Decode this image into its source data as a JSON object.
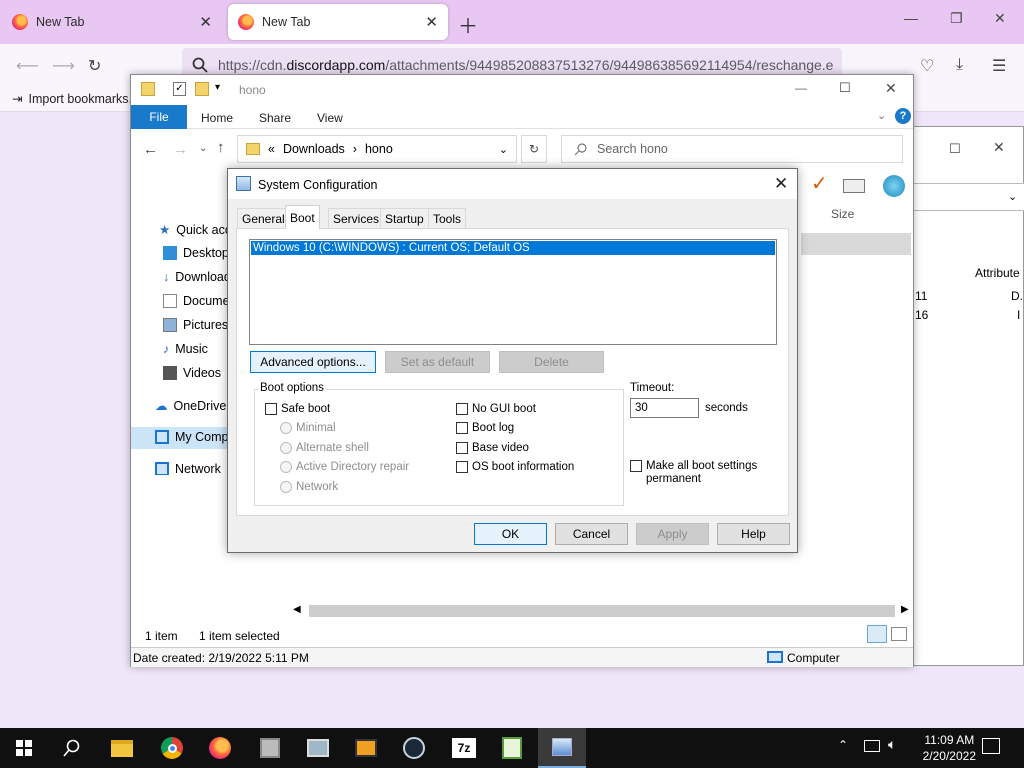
{
  "browser": {
    "tabs": [
      {
        "title": "New Tab"
      },
      {
        "title": "New Tab"
      }
    ],
    "url_prefix": "https://cdn.",
    "url_host": "discordapp.com",
    "url_rest": "/attachments/944985208837513276/944986385692114954/reschange.e",
    "bookmark_import": "Import bookmarks..."
  },
  "explorer": {
    "title": "hono",
    "ribbon_tabs": {
      "file": "File",
      "home": "Home",
      "share": "Share",
      "view": "View"
    },
    "breadcrumb": {
      "parent": "Downloads",
      "current": "hono"
    },
    "search_placeholder": "Search hono",
    "nav": {
      "quick_access": "Quick access",
      "desktop": "Desktop",
      "downloads": "Downloads",
      "documents": "Documents",
      "pictures": "Pictures",
      "music": "Music",
      "videos": "Videos",
      "onedrive": "OneDrive",
      "my_computer": "My Computer",
      "network": "Network"
    },
    "columns": {
      "size": "Size"
    },
    "status": {
      "count": "1 item",
      "selected": "1 item selected"
    },
    "details": {
      "created": "Date created: 2/19/2022 5:11 PM",
      "location": "Computer"
    }
  },
  "explorer_back": {
    "column_attributes": "Attribute",
    "row1_value": "11",
    "row1_attr": "D.",
    "row2_value": "16",
    "row2_attr": "I"
  },
  "dialog": {
    "title": "System Configuration",
    "tabs": [
      "General",
      "Boot",
      "Services",
      "Startup",
      "Tools"
    ],
    "os_entries": [
      "Windows 10 (C:\\WINDOWS) : Current OS; Default OS"
    ],
    "buttons": {
      "advanced": "Advanced options...",
      "set_default": "Set as default",
      "delete": "Delete",
      "ok": "OK",
      "cancel": "Cancel",
      "apply": "Apply",
      "help": "Help"
    },
    "boot_options_label": "Boot options",
    "safe_boot": "Safe boot",
    "safe_boot_modes": [
      "Minimal",
      "Alternate shell",
      "Active Directory repair",
      "Network"
    ],
    "right_options": [
      "No GUI boot",
      "Boot log",
      "Base video",
      "OS boot information"
    ],
    "timeout_label": "Timeout:",
    "timeout_value": "30",
    "timeout_unit": "seconds",
    "make_permanent": "Make all boot settings permanent"
  },
  "taskbar": {
    "time": "11:09 AM",
    "date": "2/20/2022"
  },
  "colors": {
    "accent": "#0078d7",
    "browser_frame": "#e8c8f2",
    "file_tab": "#1979ca"
  }
}
